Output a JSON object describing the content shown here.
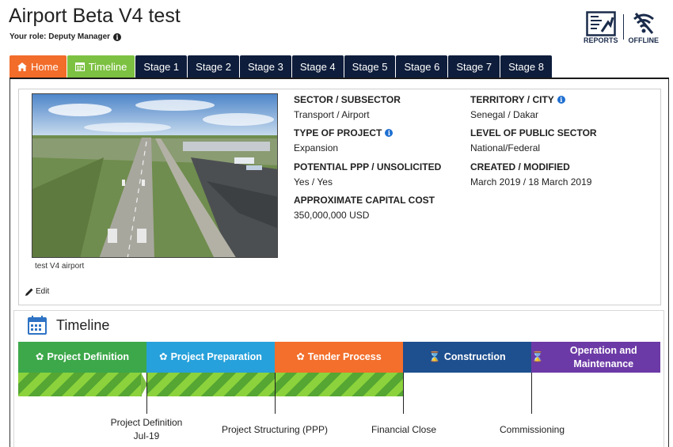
{
  "project": {
    "title": "Airport Beta V4 test",
    "role": "Your role: Deputy Manager"
  },
  "actions": {
    "reports_label": "REPORTS",
    "offline_label": "OFFLINE"
  },
  "tabs": [
    {
      "label": "Home",
      "icon": "home-icon"
    },
    {
      "label": "Timeline",
      "icon": "calendar-icon"
    },
    {
      "label": "Stage 1"
    },
    {
      "label": "Stage 2"
    },
    {
      "label": "Stage 3"
    },
    {
      "label": "Stage 4"
    },
    {
      "label": "Stage 5"
    },
    {
      "label": "Stage 6"
    },
    {
      "label": "Stage 7"
    },
    {
      "label": "Stage 8"
    }
  ],
  "details": {
    "image_caption": "test V4 airport",
    "edit_label": "Edit",
    "sector": {
      "label": "SECTOR / SUBSECTOR",
      "value": "Transport / Airport"
    },
    "type": {
      "label": "TYPE OF PROJECT",
      "value": "Expansion"
    },
    "ppp": {
      "label": "POTENTIAL PPP / UNSOLICITED",
      "value": "Yes / Yes"
    },
    "cost": {
      "label": "APPROXIMATE CAPITAL COST",
      "value": "350,000,000 USD"
    },
    "territory": {
      "label": "TERRITORY / CITY",
      "value": "Senegal / Dakar"
    },
    "level": {
      "label": "LEVEL OF PUBLIC SECTOR",
      "value": "National/Federal"
    },
    "created": {
      "label": "CREATED / MODIFIED",
      "value": "March 2019 / 18 March 2019"
    }
  },
  "timeline": {
    "title": "Timeline",
    "phases": [
      {
        "label": "Project Definition"
      },
      {
        "label": "Project Preparation"
      },
      {
        "label": "Tender Process"
      },
      {
        "label": "Construction"
      },
      {
        "label": "Operation and Maintenance"
      }
    ],
    "milestones": [
      {
        "label": "Project Definition",
        "date": "Jul-19"
      },
      {
        "label": "Project Structuring (PPP)"
      },
      {
        "label": "Financial Close"
      },
      {
        "label": "Commissioning"
      }
    ]
  },
  "colors": {
    "home_tab": "#f26c2a",
    "timeline_tab": "#7dc142",
    "stage_tab": "#0e1d3b",
    "phase_definition": "#3da84a",
    "phase_preparation": "#26a1db",
    "phase_tender": "#f36f2b",
    "phase_construction": "#1e4f8f",
    "phase_operation": "#6c3aa6"
  }
}
